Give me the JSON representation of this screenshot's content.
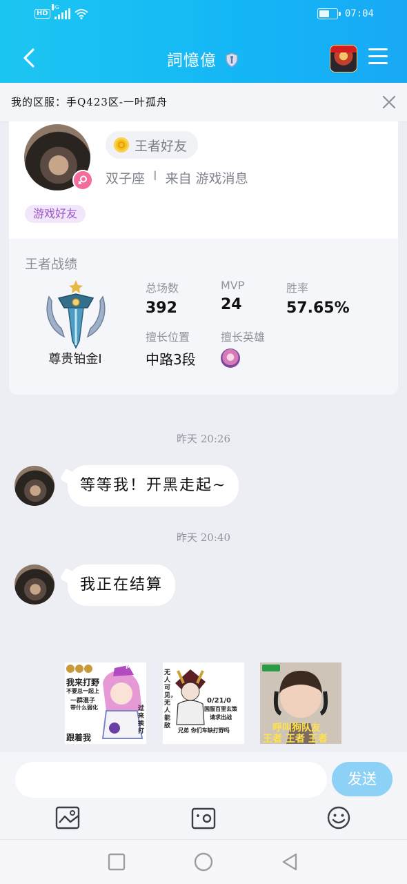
{
  "status_bar": {
    "hd": "HD",
    "network": "4G",
    "time": "07:04"
  },
  "header": {
    "title": "詞憶億",
    "back_icon": "chevron-left-icon",
    "menu_icon": "hamburger-icon"
  },
  "server_bar": {
    "text": "我的区服：手Q423区-一叶孤舟"
  },
  "profile": {
    "friend_badge": "王者好友",
    "zodiac": "双子座",
    "separator": "I",
    "source": "来自 游戏消息",
    "tag": "游戏好友"
  },
  "record": {
    "title": "王者战绩",
    "rank_name": "尊贵铂金I",
    "total_games_label": "总场数",
    "total_games_value": "392",
    "mvp_label": "MVP",
    "mvp_value": "24",
    "winrate_label": "胜率",
    "winrate_value": "57.65%",
    "position_label": "擅长位置",
    "position_value": "中路3段",
    "hero_label": "擅长英雄"
  },
  "chat": {
    "messages": [
      {
        "time": "昨天 20:26",
        "text": "等等我！开黑走起~"
      },
      {
        "time": "昨天 20:40",
        "text": "我正在结算"
      }
    ]
  },
  "stickers": {
    "s1": {
      "line1": "我来打野",
      "line2": "不要总一起上",
      "line3": "一群混子",
      "line4": "带什么弱化",
      "line5": "过来挨打",
      "line6": "跟着我",
      "badge": "MVP"
    },
    "s2": {
      "line1": "无人可见，无人能敌",
      "line2": "0/21/0",
      "line3": "国服百里玄策",
      "line4": "请求出战",
      "line5": "兄弟 你们车缺打野吗"
    },
    "s3": {
      "line1": "呼叫狗队友",
      "line2": "王者 王者 王者"
    }
  },
  "input": {
    "placeholder": "",
    "send_label": "发送"
  },
  "colors": {
    "accent": "#14b6f5",
    "send_bg": "#8dd2f6",
    "tag_text": "#9a56c5",
    "gender": "#f36c9c"
  }
}
